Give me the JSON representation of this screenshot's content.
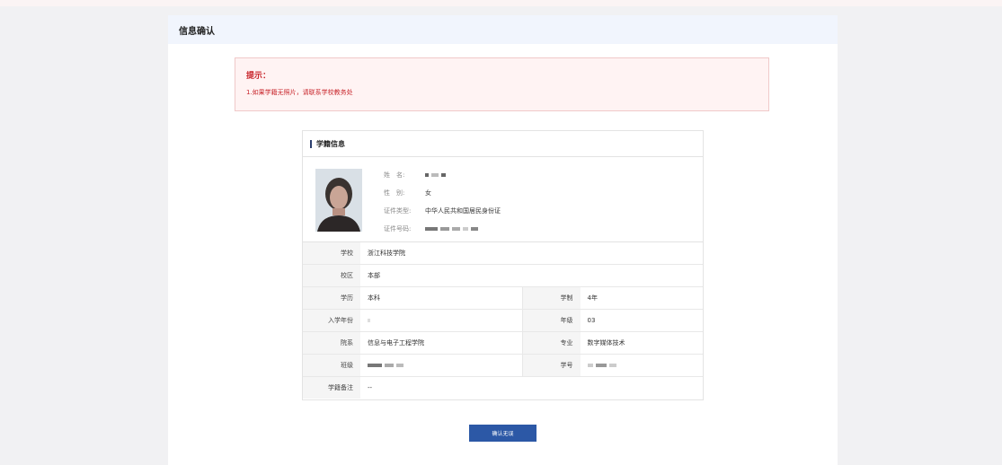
{
  "header": {
    "title": "信息确认"
  },
  "tip": {
    "title": "提示：",
    "text": "1.如果学籍无照片，请联系学校教务处"
  },
  "section": {
    "title": "学籍信息"
  },
  "profile": {
    "name_label": "姓　名:",
    "gender_label": "性　别:",
    "gender": "女",
    "id_type_label": "证件类型:",
    "id_type": "中华人民共和国居民身份证",
    "id_no_label": "证件号码:"
  },
  "rows": {
    "school_label": "学校",
    "school": "浙江科技学院",
    "campus_label": "校区",
    "campus": "本部",
    "degree_label": "学历",
    "degree": "本科",
    "duration_label": "学制",
    "duration": "4年",
    "year_label": "入学年份",
    "year": "",
    "grade_label": "年级",
    "grade": "03",
    "dept_label": "院系",
    "dept": "信息与电子工程学院",
    "major_label": "专业",
    "major": "数字媒体技术",
    "class_label": "班级",
    "stuno_label": "学号",
    "remark_label": "学籍备注",
    "remark": "--"
  },
  "button": {
    "label": "确认无误"
  },
  "colors": {
    "accent": "#2c58a6",
    "tip_text": "#c8252b",
    "header_bg": "#f1f5fd"
  }
}
